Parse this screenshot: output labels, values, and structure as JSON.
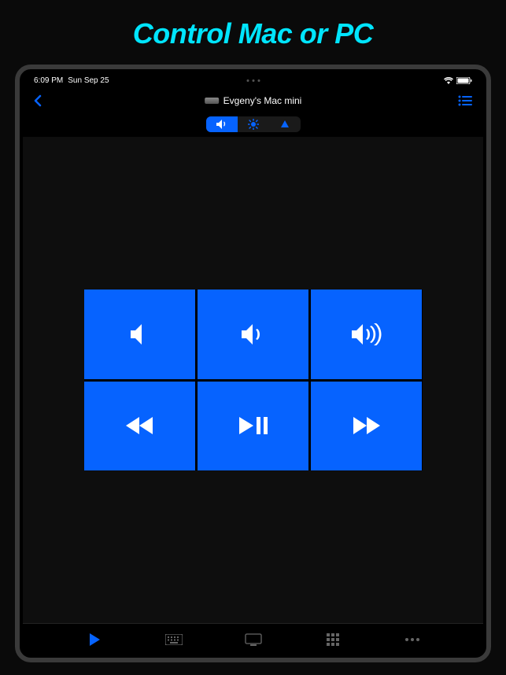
{
  "promo": {
    "title": "Control Mac or PC"
  },
  "statusBar": {
    "time": "6:09 PM",
    "date": "Sun Sep 25"
  },
  "navBar": {
    "deviceName": "Evgeny's Mac mini"
  },
  "segmented": {
    "items": [
      "volume",
      "brightness",
      "navigate"
    ],
    "active": 0
  },
  "controls": {
    "topRow": [
      "mute",
      "volume-down",
      "volume-up"
    ],
    "bottomRow": [
      "rewind",
      "play-pause",
      "forward"
    ]
  },
  "tabs": {
    "items": [
      "play",
      "keyboard",
      "screen",
      "grid",
      "more"
    ],
    "active": 0
  },
  "colors": {
    "accent": "#0663ff",
    "promoTitle": "#00e5ff"
  }
}
